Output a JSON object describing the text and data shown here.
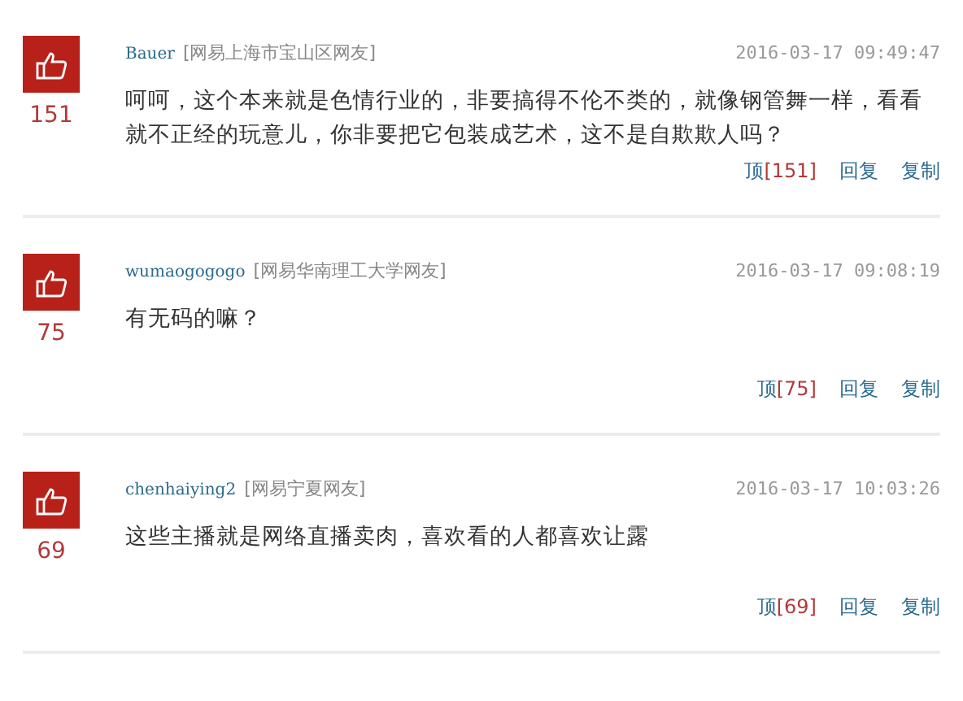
{
  "comments": [
    {
      "votes": "151",
      "user": "Bauer",
      "location": "[网易上海市宝山区网友]",
      "time": "2016-03-17 09:49:47",
      "text": "呵呵，这个本来就是色情行业的，非要搞得不伦不类的，就像钢管舞一样，看看就不正经的玩意儿，你非要把它包装成艺术，这不是自欺欺人吗？",
      "actions": {
        "up": "顶",
        "up_count": "[151]",
        "reply": "回复",
        "copy": "复制"
      }
    },
    {
      "votes": "75",
      "user": "wumaogogogo",
      "location": "[网易华南理工大学网友]",
      "time": "2016-03-17 09:08:19",
      "text": "有无码的嘛？",
      "actions": {
        "up": "顶",
        "up_count": "[75]",
        "reply": "回复",
        "copy": "复制"
      }
    },
    {
      "votes": "69",
      "user": "chenhaiying2",
      "location": "[网易宁夏网友]",
      "time": "2016-03-17 10:03:26",
      "text": "这些主播就是网络直播卖肉，喜欢看的人都喜欢让露",
      "actions": {
        "up": "顶",
        "up_count": "[69]",
        "reply": "回复",
        "copy": "复制"
      }
    }
  ]
}
